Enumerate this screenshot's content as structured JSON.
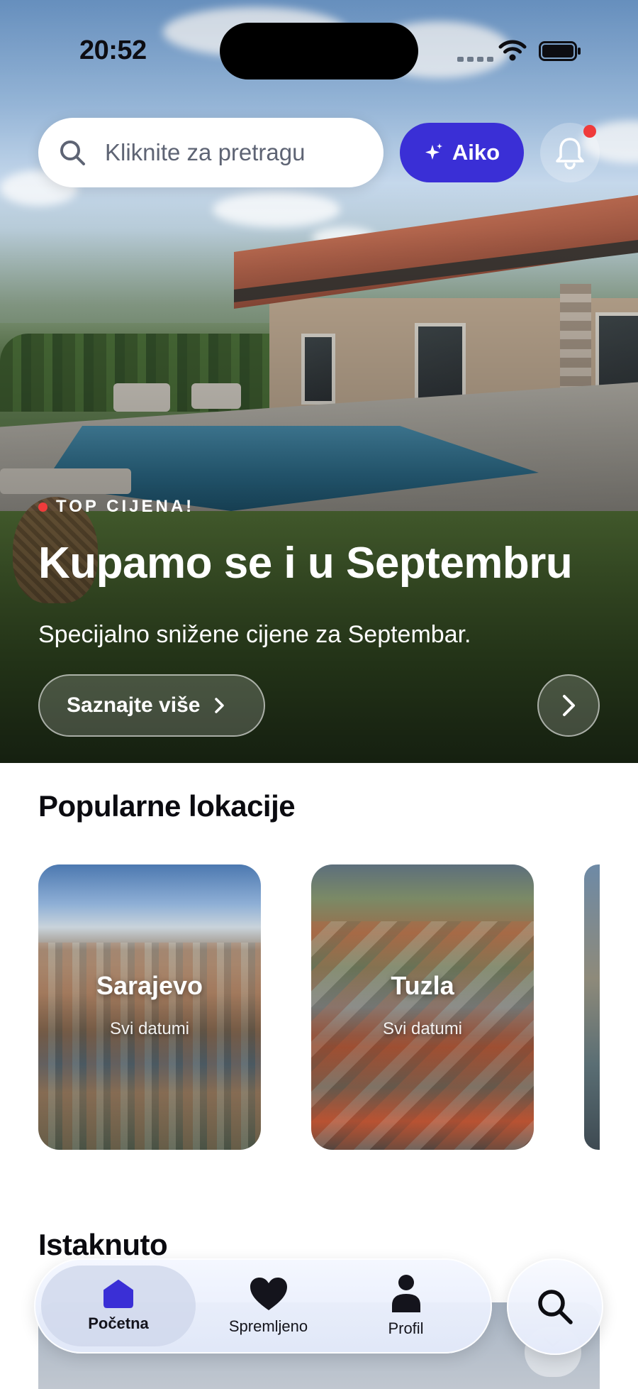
{
  "status_bar": {
    "time": "20:52"
  },
  "search": {
    "placeholder": "Kliknite za pretragu"
  },
  "aiko": {
    "label": "Aiko"
  },
  "hero": {
    "tag": "TOP CIJENA!",
    "title": "Kupamo se i u Septembru",
    "subtitle": "Specijalno snižene cijene za Septembar.",
    "cta_label": "Saznajte više"
  },
  "popular": {
    "title": "Popularne lokacije",
    "items": [
      {
        "name": "Sarajevo",
        "subtitle": "Svi datumi"
      },
      {
        "name": "Tuzla",
        "subtitle": "Svi datumi"
      }
    ]
  },
  "featured": {
    "title": "Istaknuto"
  },
  "tabbar": {
    "items": [
      {
        "label": "Početna",
        "icon": "home-icon",
        "active": true
      },
      {
        "label": "Spremljeno",
        "icon": "heart-icon",
        "active": false
      },
      {
        "label": "Profil",
        "icon": "profile-icon",
        "active": false
      }
    ]
  },
  "colors": {
    "accent": "#3a2fd6",
    "notification_dot": "#ef3b3b",
    "home_icon": "#3a2fd6"
  }
}
